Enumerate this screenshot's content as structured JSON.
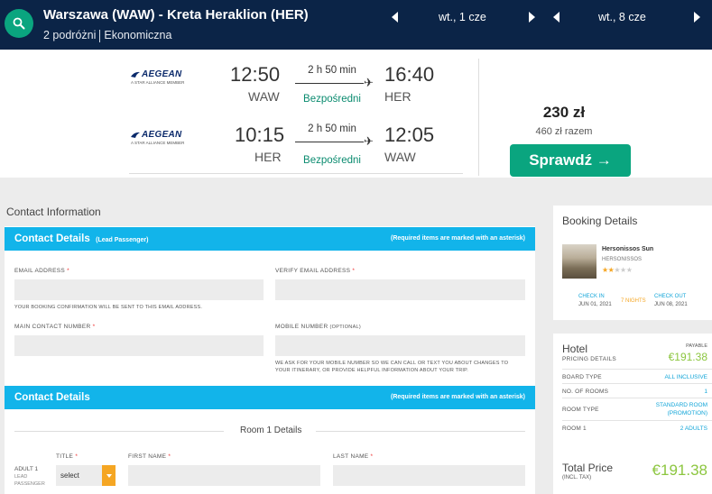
{
  "header": {
    "route": "Warszawa (WAW) - Kreta Heraklion (HER)",
    "travellers": "2 podróżni",
    "cabin": "Ekonomiczna",
    "depart_date": "wt., 1 cze",
    "return_date": "wt., 8 cze"
  },
  "flights": {
    "airline_name": "AEGEAN",
    "airline_sub": "A STAR ALLIANCE MEMBER",
    "legs": [
      {
        "dep_time": "12:50",
        "dep_code": "WAW",
        "duration": "2 h 50 min",
        "stops": "Bezpośredni",
        "arr_time": "16:40",
        "arr_code": "HER"
      },
      {
        "dep_time": "10:15",
        "dep_code": "HER",
        "duration": "2 h 50 min",
        "stops": "Bezpośredni",
        "arr_time": "12:05",
        "arr_code": "WAW"
      }
    ],
    "price": "230 zł",
    "price_total": "460 zł razem",
    "check_button": "Sprawdź →"
  },
  "form": {
    "section_title": "Contact Information",
    "bar1": {
      "title": "Contact Details",
      "subtitle": "(Lead Passenger)",
      "required_note": "(Required items are marked with an asterisk)"
    },
    "email_label": "EMAIL ADDRESS",
    "verify_email_label": "VERIFY EMAIL ADDRESS",
    "email_note": "YOUR BOOKING CONFIRMATION WILL BE SENT TO THIS EMAIL ADDRESS.",
    "main_contact_label": "MAIN CONTACT NUMBER",
    "mobile_label": "MOBILE NUMBER",
    "mobile_optional": "(OPTIONAL)",
    "mobile_note_1": "WE ASK FOR YOUR MOBILE NUMBER SO WE CAN CALL OR TEXT YOU ABOUT CHANGES TO",
    "mobile_note_2": "YOUR ITINERARY, OR PROVIDE HELPFUL INFORMATION ABOUT YOUR TRIP.",
    "bar2": {
      "title": "Contact Details",
      "required_note": "(Required items are marked with an asterisk)"
    },
    "room_title": "Room 1 Details",
    "adult_label": "ADULT 1",
    "adult_sub_1": "LEAD",
    "adult_sub_2": "PASSENGER",
    "title_label": "TITLE",
    "title_value": "select",
    "first_name_label": "FIRST NAME",
    "last_name_label": "LAST NAME",
    "asterisk": "*"
  },
  "booking": {
    "title": "Booking Details",
    "hotel_name": "Hersonissos Sun",
    "hotel_location": "HERSONISSOS",
    "stars": 2,
    "stars_max": 5,
    "check_in_label": "CHECK IN",
    "check_in_date": "JUN 01, 2021",
    "nights": "7 NIGHTS",
    "check_out_label": "CHECK OUT",
    "check_out_date": "JUN 08, 2021"
  },
  "pricing": {
    "hotel_label": "Hotel",
    "sub_label": "PRICING DETAILS",
    "payable_label": "PAYABLE",
    "payable_amount": "€191.38",
    "rows": [
      {
        "key": "BOARD TYPE",
        "value": "ALL INCLUSIVE"
      },
      {
        "key": "NO. OF ROOMS",
        "value": "1"
      },
      {
        "key": "ROOM TYPE",
        "value": "STANDARD ROOM",
        "value2": "(PROMOTION)"
      },
      {
        "key": "ROOM 1",
        "value": "2 ADULTS"
      }
    ],
    "total_label": "Total Price",
    "total_sub": "(INCL. TAX)",
    "total_amount": "€191.38"
  },
  "colors": {
    "navy": "#0b2447",
    "green": "#0aa57f",
    "blue": "#12b4ea",
    "lime": "#8cc63f",
    "orange": "#f5a623"
  }
}
